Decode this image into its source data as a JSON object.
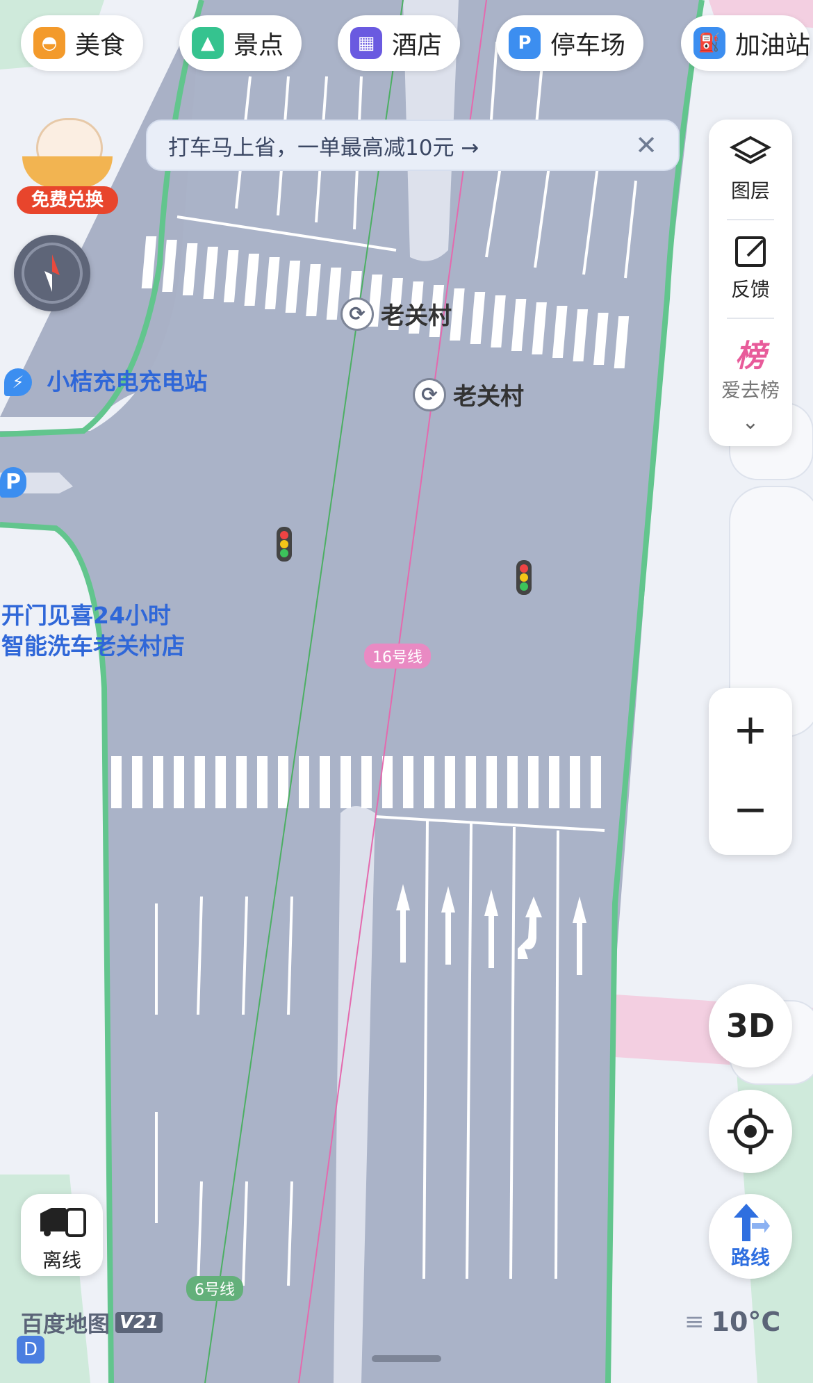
{
  "categories": [
    {
      "label": "美食",
      "icon": "food-icon",
      "color": "#f39a2b"
    },
    {
      "label": "景点",
      "icon": "scenic-icon",
      "color": "#35c38f"
    },
    {
      "label": "酒店",
      "icon": "hotel-icon",
      "color": "#6a5ae0"
    },
    {
      "label": "停车场",
      "icon": "parking-icon",
      "color": "#3c8ef0"
    },
    {
      "label": "加油站",
      "icon": "gas-station-icon",
      "color": "#3c8ef0"
    }
  ],
  "banner": {
    "text": "打车马上省，一单最高减10元 →",
    "close": "✕"
  },
  "promo": {
    "label": "免费兑换"
  },
  "side_panel": {
    "layers": "图层",
    "feedback": "反馈",
    "ranking_icon_text": "榜",
    "ranking": "爱去榜"
  },
  "zoom": {
    "in": "+",
    "out": "−"
  },
  "buttons": {
    "three_d": "3D",
    "route": "路线",
    "offline": "离线"
  },
  "map_labels": {
    "charging_station": "小桔充电充电站",
    "car_wash_line1": "开门见喜24小时",
    "car_wash_line2": "智能洗车老关村店",
    "station_1": "老关村",
    "station_2": "老关村",
    "line_16": "16号线",
    "line_6": "6号线",
    "parking_marker": "P"
  },
  "footer": {
    "brand": "百度地图",
    "version": "V21",
    "temperature": "10°C",
    "d_badge": "D"
  }
}
